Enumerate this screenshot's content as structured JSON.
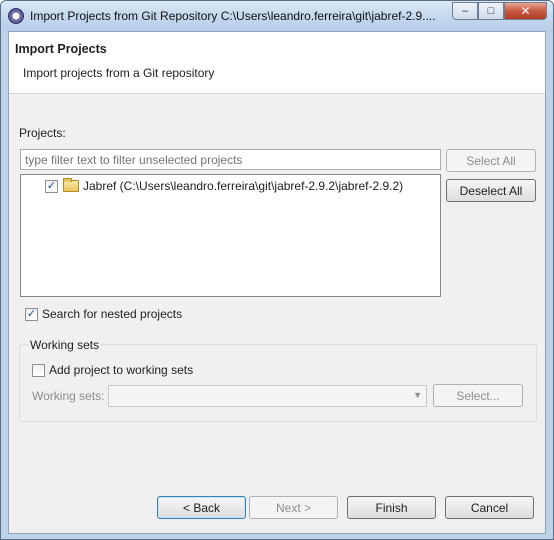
{
  "window": {
    "title": "Import Projects from Git Repository C:\\Users\\leandro.ferreira\\git\\jabref-2.9....",
    "minimize_glyph": "–",
    "maximize_glyph": "□",
    "close_glyph": "✕"
  },
  "banner": {
    "title": "Import Projects",
    "description": "Import projects from a Git repository"
  },
  "projects": {
    "label": "Projects:",
    "filter_placeholder": "type filter text to filter unselected projects",
    "select_all_label": "Select All",
    "deselect_all_label": "Deselect All",
    "items": [
      {
        "label": "Jabref (C:\\Users\\leandro.ferreira\\git\\jabref-2.9.2\\jabref-2.9.2)",
        "checked": true,
        "icon": "folder-icon"
      }
    ]
  },
  "options": {
    "nested_label": "Search for nested projects",
    "nested_checked": true
  },
  "working_sets": {
    "group_label": "Working sets",
    "add_label": "Add project to working sets",
    "add_checked": false,
    "field_label": "Working sets:",
    "selected_value": "",
    "select_button_label": "Select..."
  },
  "footer": {
    "back_label": "< Back",
    "next_label": "Next >",
    "finish_label": "Finish",
    "cancel_label": "Cancel"
  },
  "check_glyph": "✓",
  "colors": {
    "titlebar": "#c3d7ee",
    "dialog_bg": "#f0f0f0",
    "default_button_border": "#3c7fb1",
    "disabled_text": "#8d8d8d"
  }
}
